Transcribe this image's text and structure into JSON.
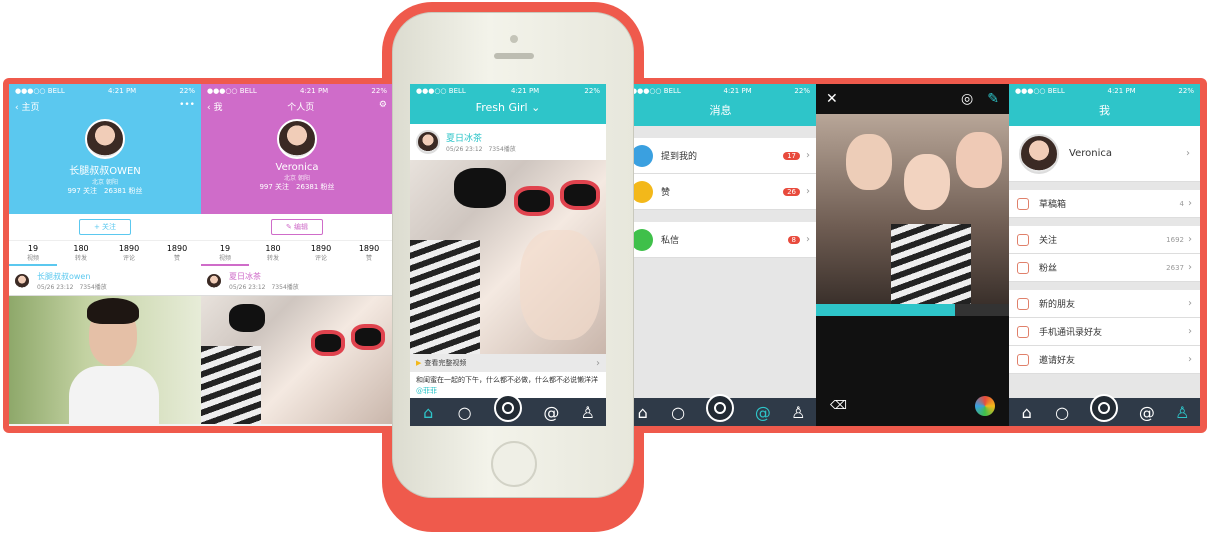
{
  "status": {
    "carrier": "●●●○○ BELL",
    "time": "4:21 PM",
    "battery": "22%"
  },
  "s1": {
    "back": "主页",
    "more": "•••",
    "name": "长腿叔叔OWEN",
    "loc": "北京 朝阳",
    "fans_line": "997 关注　26381 粉丝",
    "follow": "+ 关注",
    "stats": [
      {
        "n": "19",
        "l": "视频"
      },
      {
        "n": "180",
        "l": "转发"
      },
      {
        "n": "1890",
        "l": "评论"
      },
      {
        "n": "1890",
        "l": "赞"
      }
    ],
    "post_user": "长腿叔叔owen",
    "post_meta": "05/26 23:12　7354播放"
  },
  "s2": {
    "back": "我",
    "title": "个人页",
    "name": "Veronica",
    "loc": "北京 朝阳",
    "fans_line": "997 关注　26381 粉丝",
    "edit": "✎ 编辑",
    "stats": [
      {
        "n": "19",
        "l": "视频"
      },
      {
        "n": "180",
        "l": "转发"
      },
      {
        "n": "1890",
        "l": "评论"
      },
      {
        "n": "1890",
        "l": "赞"
      }
    ],
    "post_user": "夏日冰茶",
    "post_meta": "05/26 23:12　7354播放"
  },
  "s3": {
    "title": "Fresh Girl ⌄",
    "post_user": "夏日冰茶",
    "post_meta": "05/26 23:12　7354播放",
    "full_video": "查看完整视频",
    "caption": "和闺蜜在一起的下午，什么都不必做，什么都不必说懒洋洋",
    "tag": "@菲菲"
  },
  "s4": {
    "title": "消息",
    "rows": [
      {
        "label": "提到我的",
        "badge": "17",
        "color": "#3aa0e0"
      },
      {
        "label": "赞",
        "badge": "26",
        "color": "#f3b81a"
      },
      {
        "label": "私信",
        "badge": "8",
        "color": "#3fc04a"
      }
    ]
  },
  "s6": {
    "title": "我",
    "name": "Veronica",
    "rows": [
      {
        "label": "草稿箱",
        "val": "4"
      },
      {
        "label": "关注",
        "val": "1692"
      },
      {
        "label": "粉丝",
        "val": "2637"
      },
      {
        "label": "新的朋友",
        "val": ""
      },
      {
        "label": "手机通讯录好友",
        "val": ""
      },
      {
        "label": "邀请好友",
        "val": ""
      }
    ]
  },
  "colors": {
    "frame": "#ef5a4c",
    "teal": "#2ec5c9",
    "blue": "#5bc8ef",
    "purple": "#cf6cc9",
    "dark": "#2f3a48"
  }
}
